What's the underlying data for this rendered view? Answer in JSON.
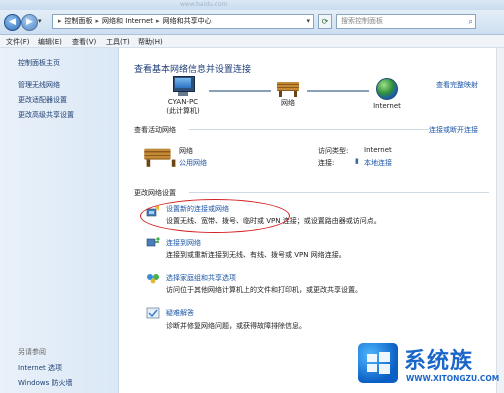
{
  "titlebar": {
    "ghost_url": "www.baidu.com"
  },
  "address": {
    "crumbs": [
      "控制面板",
      "网络和 Internet",
      "网络和共享中心"
    ],
    "search_placeholder": "搜索控制面板"
  },
  "menu": [
    "文件(F)",
    "编辑(E)",
    "查看(V)",
    "工具(T)",
    "帮助(H)"
  ],
  "sidebar": {
    "items": [
      "控制面板主页",
      "管理无线网络",
      "更改适配器设置",
      "更改高级共享设置"
    ],
    "see_also": "另请参阅",
    "also_items": [
      "Internet 选项",
      "Windows 防火墙"
    ]
  },
  "main": {
    "heading": "查看基本网络信息并设置连接",
    "view_full_map": "查看完整映射",
    "nodes": {
      "pc_name": "CYAN-PC",
      "pc_sub": "(此计算机)",
      "network": "网络",
      "internet": "Internet"
    },
    "active_label": "查看活动网络",
    "connect_disconnect": "连接或断开连接",
    "active": {
      "name": "网络",
      "type": "公用网络",
      "access_type_label": "访问类型:",
      "access_type_value": "Internet",
      "connection_label": "连接:",
      "connection_value": "本地连接"
    },
    "change_label": "更改网络设置",
    "tasks": [
      {
        "title": "设置新的连接或网络",
        "desc": "设置无线、宽带、拨号、临时或 VPN 连接；或设置路由器或访问点。"
      },
      {
        "title": "连接到网络",
        "desc": "连接到或重新连接到无线、有线、拨号或 VPN 网络连接。"
      },
      {
        "title": "选择家庭组和共享选项",
        "desc": "访问位于其他网络计算机上的文件和打印机，或更改共享设置。"
      },
      {
        "title": "疑难解答",
        "desc": "诊断并修复网络问题，或获得故障排除信息。"
      }
    ]
  },
  "watermark": {
    "text": "系统族",
    "url": "WWW.XITONGZU.COM"
  },
  "colors": {
    "link": "#1b55a6",
    "highlight_oval": "#d32020",
    "heading": "#1f3e7a"
  }
}
